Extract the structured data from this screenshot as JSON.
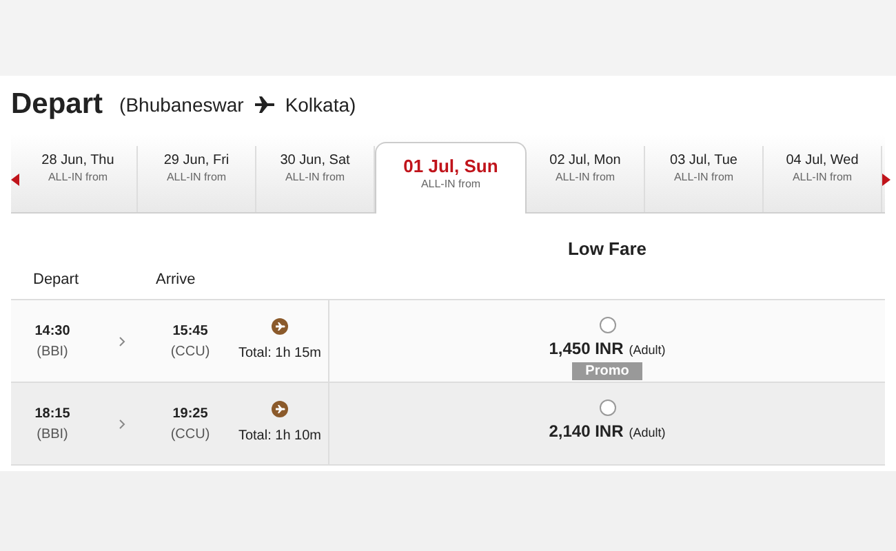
{
  "heading": {
    "title": "Depart",
    "route_from": "(Bhubaneswar",
    "route_to": "Kolkata)"
  },
  "dates": [
    {
      "date": "28 Jun, Thu",
      "caption": "ALL-IN from",
      "selected": false
    },
    {
      "date": "29 Jun, Fri",
      "caption": "ALL-IN from",
      "selected": false
    },
    {
      "date": "30 Jun, Sat",
      "caption": "ALL-IN from",
      "selected": false
    },
    {
      "date": "01 Jul, Sun",
      "caption": "ALL-IN from",
      "selected": true
    },
    {
      "date": "02 Jul, Mon",
      "caption": "ALL-IN from",
      "selected": false
    },
    {
      "date": "03 Jul, Tue",
      "caption": "ALL-IN from",
      "selected": false
    },
    {
      "date": "04 Jul, Wed",
      "caption": "ALL-IN from",
      "selected": false
    }
  ],
  "table": {
    "fare_heading": "Low Fare",
    "columns": [
      "Depart",
      "Arrive"
    ],
    "rows": [
      {
        "depart_time": "14:30",
        "depart_code": "(BBI)",
        "arrive_time": "15:45",
        "arrive_code": "(CCU)",
        "total": "Total: 1h 15m",
        "price": "1,450 INR",
        "passenger": "(Adult)",
        "badge": "Promo",
        "selected": false
      },
      {
        "depart_time": "18:15",
        "depart_code": "(BBI)",
        "arrive_time": "19:25",
        "arrive_code": "(CCU)",
        "total": "Total: 1h 10m",
        "price": "2,140 INR",
        "passenger": "(Adult)",
        "selected": false
      }
    ]
  }
}
